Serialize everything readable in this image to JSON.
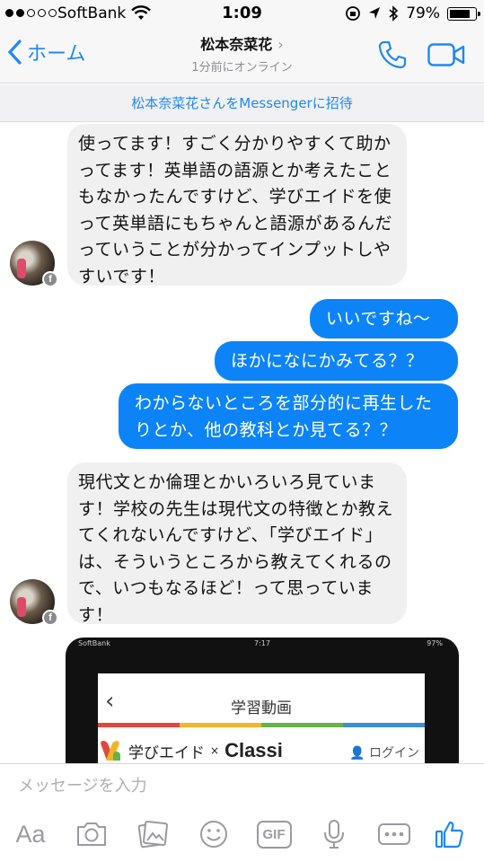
{
  "status": {
    "carrier": "SoftBank",
    "time": "1:09",
    "battery": "79%"
  },
  "header": {
    "back_label": "ホーム",
    "contact_name": "松本奈菜花",
    "presence": "1分前にオンライン",
    "invite": "松本奈菜花さんをMessengerに招待"
  },
  "messages": [
    {
      "dir": "in",
      "text": "使ってます！すごく分かりやすくて助かってます！英単語の語源とか考えたこともなかったんですけど、学びエイドを使って英単語にもちゃんと語源があるんだっていうことが分かってインプットしやすいです！"
    },
    {
      "dir": "out",
      "text": "いいですね〜"
    },
    {
      "dir": "out",
      "text": "ほかになにかみてる？？"
    },
    {
      "dir": "out",
      "text": "わからないところを部分的に再生したりとか、他の教科とか見てる？？"
    },
    {
      "dir": "in",
      "text": "現代文とか倫理とかいろいろ見ています！学校の先生は現代文の特徴とか教えてくれないんですけど、「学びエイド」は、そういうところから教えてくれるので、いつもなるほど！って思っています！"
    }
  ],
  "attachment": {
    "carrier": "SoftBank",
    "time": "7:17",
    "battery": "97%",
    "page_title": "学習動画",
    "brand": "学びエイド",
    "brand_x": "×",
    "brand_classi": "Classi",
    "login": "ログイン"
  },
  "composer": {
    "placeholder": "メッセージを入力",
    "aa_label": "Aa",
    "gif_label": "GIF",
    "icons": [
      "camera-icon",
      "gallery-icon",
      "emoji-icon",
      "gif-icon",
      "microphone-icon",
      "more-icon",
      "like-icon"
    ]
  },
  "colors": {
    "accent": "#1e88f6",
    "outgoing_bubble": "#0c84f7",
    "incoming_bubble": "#f1f0f0"
  }
}
